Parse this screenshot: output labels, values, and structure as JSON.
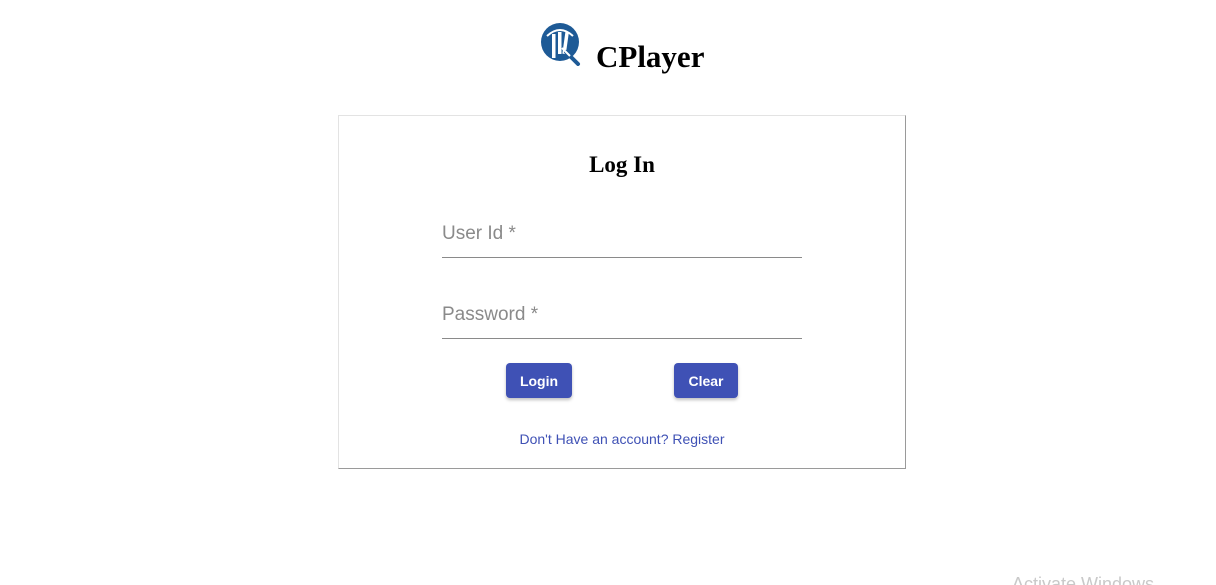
{
  "brand": {
    "name": "CPlayer",
    "logo_icon": "cricket-player-logo-icon",
    "logo_color": "#1e5a96"
  },
  "login_card": {
    "title": "Log In",
    "user_id": {
      "placeholder": "User Id *",
      "value": ""
    },
    "password": {
      "placeholder": "Password *",
      "value": ""
    },
    "login_button_label": "Login",
    "clear_button_label": "Clear",
    "register_link_text": "Don't Have an account? Register"
  },
  "watermark": {
    "text": "Activate Windows"
  },
  "colors": {
    "primary": "#3f51b5",
    "text": "#000000",
    "placeholder": "#8a8a8a"
  }
}
